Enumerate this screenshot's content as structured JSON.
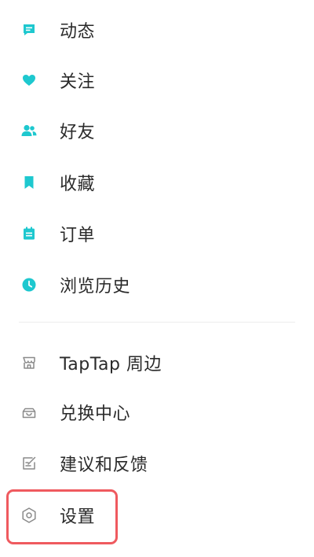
{
  "menu": {
    "primary": [
      {
        "label": "动态",
        "icon": "feed-icon"
      },
      {
        "label": "关注",
        "icon": "heart-icon"
      },
      {
        "label": "好友",
        "icon": "friends-icon"
      },
      {
        "label": "收藏",
        "icon": "bookmark-icon"
      },
      {
        "label": "订单",
        "icon": "order-icon"
      },
      {
        "label": "浏览历史",
        "icon": "history-icon"
      }
    ],
    "secondary": [
      {
        "label": "TapTap 周边",
        "icon": "shop-icon"
      },
      {
        "label": "兑换中心",
        "icon": "redeem-icon"
      },
      {
        "label": "建议和反馈",
        "icon": "feedback-icon"
      },
      {
        "label": "设置",
        "icon": "settings-icon"
      }
    ]
  },
  "colors": {
    "accent": "#1ec8cf",
    "outline_icon": "#8a8a8a",
    "text": "#2a2a2a",
    "highlight": "#ef5a5f"
  }
}
